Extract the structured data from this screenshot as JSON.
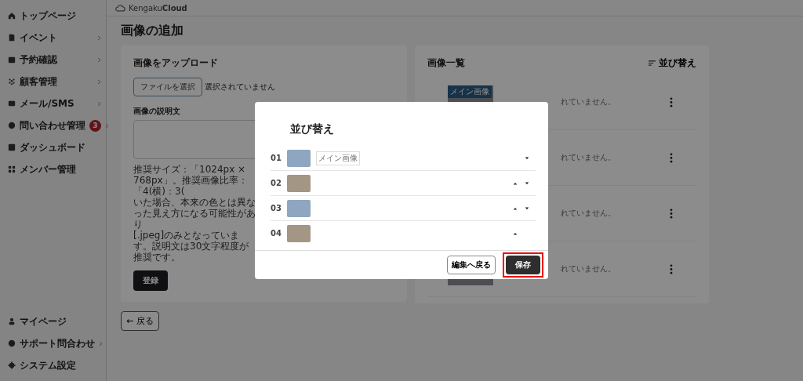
{
  "sidebar": {
    "items": [
      {
        "kind": "home",
        "label": "トップページ",
        "chevron": false
      },
      {
        "kind": "doc",
        "label": "イベント",
        "chevron": true
      },
      {
        "kind": "calendar",
        "label": "予約確認",
        "chevron": true
      },
      {
        "kind": "people",
        "label": "顧客管理",
        "chevron": true
      },
      {
        "kind": "mail",
        "label": "メール/SMS",
        "chevron": true
      },
      {
        "kind": "chat",
        "label": "問い合わせ管理",
        "chevron": true,
        "badge": "3"
      },
      {
        "kind": "chart",
        "label": "ダッシュボード",
        "chevron": false
      },
      {
        "kind": "grid",
        "label": "メンバー管理",
        "chevron": false
      }
    ],
    "bottom_items": [
      {
        "kind": "person",
        "label": "マイページ",
        "chevron": false
      },
      {
        "kind": "help",
        "label": "サポート問合わせ",
        "chevron": true
      },
      {
        "kind": "gear",
        "label": "システム設定",
        "chevron": false
      }
    ]
  },
  "header": {
    "logo_light": "Kengaku",
    "logo_bold": "Cloud"
  },
  "page": {
    "title": "画像の追加",
    "upload": {
      "title": "画像をアップロード",
      "file_button": "ファイルを選択",
      "file_status": "選択されていません",
      "description_label": "画像の説明文",
      "hint": "推奨サイズ：「1024px × 768px」。推奨画像比率：「4(横)：3(",
      "hint_2": "いた場合、本来の色とは異なった見え方になる可能性があり",
      "hint_3": "[.jpeg]のみとなっています。説明文は30文字程度が推奨です。",
      "submit": "登録"
    },
    "gallery": {
      "title": "画像一覧",
      "sort_button": "並び替え",
      "items": [
        {
          "badge": "メイン画像",
          "status": "れていません。"
        },
        {
          "status": "れていません。"
        },
        {
          "status": "れていません。"
        },
        {
          "status": "れていません。"
        }
      ]
    },
    "back_button": "← 戻る"
  },
  "modal": {
    "title": "並び替え",
    "rows": [
      {
        "number": "01",
        "badge": "メイン画像",
        "can_move_up": false,
        "can_move_down": true
      },
      {
        "number": "02",
        "can_move_up": true,
        "can_move_down": true
      },
      {
        "number": "03",
        "can_move_up": true,
        "can_move_down": true
      },
      {
        "number": "04",
        "can_move_up": true,
        "can_move_down": false
      }
    ],
    "cancel_button": "編集へ戻る",
    "save_button": "保存",
    "save_highlighted": true
  }
}
